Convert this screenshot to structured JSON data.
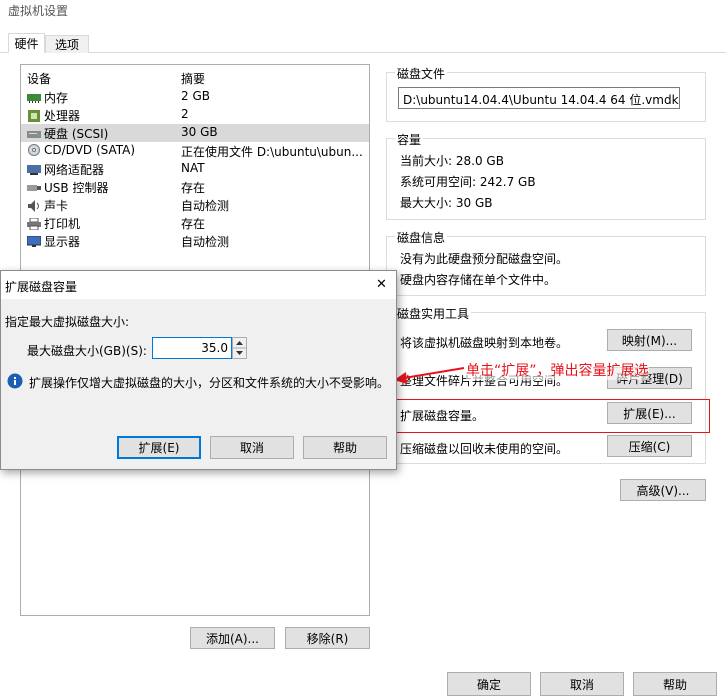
{
  "window": {
    "title": "虚拟机设置"
  },
  "tabs": [
    {
      "label": "硬件"
    },
    {
      "label": "选项"
    }
  ],
  "device_list": {
    "headers": {
      "device": "设备",
      "summary": "摘要"
    },
    "rows": [
      {
        "icon": "memory-icon",
        "device": "内存",
        "summary": "2 GB"
      },
      {
        "icon": "processor-icon",
        "device": "处理器",
        "summary": "2"
      },
      {
        "icon": "hard-disk-icon",
        "device": "硬盘 (SCSI)",
        "summary": "30 GB"
      },
      {
        "icon": "cd-dvd-icon",
        "device": "CD/DVD (SATA)",
        "summary": "正在使用文件 D:\\ubuntu\\ubun..."
      },
      {
        "icon": "network-adapter-icon",
        "device": "网络适配器",
        "summary": "NAT"
      },
      {
        "icon": "usb-icon",
        "device": "USB 控制器",
        "summary": "存在"
      },
      {
        "icon": "sound-card-icon",
        "device": "声卡",
        "summary": "自动检测"
      },
      {
        "icon": "printer-icon",
        "device": "打印机",
        "summary": "存在"
      },
      {
        "icon": "display-icon",
        "device": "显示器",
        "summary": "自动检测"
      }
    ],
    "add_button": "添加(A)...",
    "remove_button": "移除(R)"
  },
  "disk_file": {
    "title": "磁盘文件",
    "path": "D:\\ubuntu14.04.4\\Ubuntu 14.04.4 64 位.vmdk"
  },
  "capacity": {
    "title": "容量",
    "current_size": "当前大小: 28.0 GB",
    "system_free": "系统可用空间: 242.7 GB",
    "max_size": "最大大小: 30 GB"
  },
  "disk_info": {
    "title": "磁盘信息",
    "line1": "没有为此硬盘预分配磁盘空间。",
    "line2": "硬盘内容存储在单个文件中。"
  },
  "disk_utilities": {
    "title": "磁盘实用工具",
    "map_text": "将该虚拟机磁盘映射到本地卷。",
    "map_button": "映射(M)...",
    "defrag_text": "整理文件碎片并整合可用空间。",
    "defrag_button": "碎片整理(D)",
    "expand_text": "扩展磁盘容量。",
    "expand_button": "扩展(E)...",
    "compact_text": "压缩磁盘以回收未使用的空间。",
    "compact_button": "压缩(C)"
  },
  "advanced_button": "高级(V)...",
  "annotation": "单击“扩展”，弹出容量扩展选",
  "footer": {
    "ok": "确定",
    "cancel": "取消",
    "help": "帮助"
  },
  "expand_dialog": {
    "title": "扩展磁盘容量",
    "close": "✕",
    "instruction": "指定最大虚拟磁盘大小:",
    "size_label": "最大磁盘大小(GB)(S):",
    "size_value": "35.0",
    "info_text": "扩展操作仅增大虚拟磁盘的大小，分区和文件系统的大小不受影响。",
    "expand_button": "扩展(E)",
    "cancel_button": "取消",
    "help_button": "帮助"
  },
  "colors": {
    "annotation": "#e8141b",
    "accent": "#0078d7",
    "highlight_row": "#d9d9d9"
  }
}
